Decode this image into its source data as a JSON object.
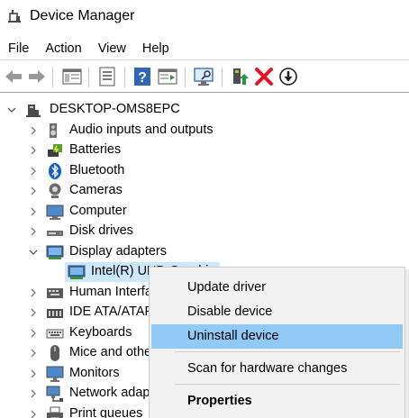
{
  "window": {
    "title": "Device Manager",
    "app_icon": "device-manager-icon"
  },
  "menubar": {
    "items": [
      "File",
      "Action",
      "View",
      "Help"
    ]
  },
  "toolbar": {
    "buttons": [
      "back-arrow-icon",
      "forward-arrow-icon",
      "show-hide-console-tree-icon",
      "properties-icon",
      "help-icon",
      "action-pane-icon",
      "scan-hardware-icon",
      "update-driver-icon",
      "uninstall-device-icon",
      "disable-device-icon"
    ]
  },
  "tree": {
    "root": "DESKTOP-OMS8EPC",
    "categories": [
      {
        "label": "Audio inputs and outputs",
        "icon": "speaker-icon",
        "expanded": false
      },
      {
        "label": "Batteries",
        "icon": "battery-icon",
        "expanded": false
      },
      {
        "label": "Bluetooth",
        "icon": "bluetooth-icon",
        "expanded": false
      },
      {
        "label": "Cameras",
        "icon": "camera-icon",
        "expanded": false
      },
      {
        "label": "Computer",
        "icon": "computer-icon",
        "expanded": false
      },
      {
        "label": "Disk drives",
        "icon": "disk-drive-icon",
        "expanded": false
      },
      {
        "label": "Display adapters",
        "icon": "display-adapter-icon",
        "expanded": true
      },
      {
        "label": "Intel(R) UHD Graphics",
        "icon": "display-adapter-icon",
        "child": true,
        "selected": true
      },
      {
        "label": "Human Interface Devices",
        "icon": "hid-icon",
        "expanded": false
      },
      {
        "label": "IDE ATA/ATAPI controllers",
        "icon": "ide-controller-icon",
        "expanded": false
      },
      {
        "label": "Keyboards",
        "icon": "keyboard-icon",
        "expanded": false
      },
      {
        "label": "Mice and other pointing devices",
        "icon": "mouse-icon",
        "expanded": false
      },
      {
        "label": "Monitors",
        "icon": "monitor-icon",
        "expanded": false
      },
      {
        "label": "Network adapters",
        "icon": "network-adapter-icon",
        "expanded": false
      },
      {
        "label": "Print queues",
        "icon": "printer-icon",
        "expanded": false
      }
    ]
  },
  "context_menu": {
    "items": [
      {
        "label": "Update driver"
      },
      {
        "label": "Disable device"
      },
      {
        "label": "Uninstall device",
        "hovered": true
      },
      {
        "label": "Scan for hardware changes"
      },
      {
        "label": "Properties",
        "bold": true
      }
    ]
  },
  "colors": {
    "selection": "#cce8ff",
    "menu_hover": "#91c9f7",
    "menu_bg": "#f2f2f2",
    "uninstall_red": "#e81123",
    "update_green": "#1e9e3a"
  }
}
